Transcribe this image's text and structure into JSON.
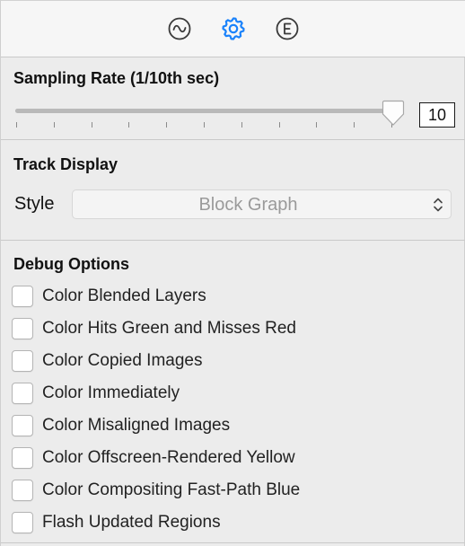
{
  "toolbar": {
    "icons": [
      {
        "name": "waveform-icon",
        "selected": false
      },
      {
        "name": "gear-icon",
        "selected": true
      },
      {
        "name": "e-circle-icon",
        "selected": false
      }
    ],
    "accent_color": "#1a82fb"
  },
  "sampling": {
    "title": "Sampling Rate (1/10th sec)",
    "value": "10",
    "slider_fraction": 1.0,
    "tick_count": 11
  },
  "track_display": {
    "title": "Track Display",
    "style_label": "Style",
    "style_value": "Block Graph"
  },
  "debug": {
    "title": "Debug Options",
    "options": [
      {
        "label": "Color Blended Layers",
        "checked": false
      },
      {
        "label": "Color Hits Green and Misses Red",
        "checked": false
      },
      {
        "label": "Color Copied Images",
        "checked": false
      },
      {
        "label": "Color Immediately",
        "checked": false
      },
      {
        "label": "Color Misaligned Images",
        "checked": false
      },
      {
        "label": "Color Offscreen-Rendered Yellow",
        "checked": false
      },
      {
        "label": "Color Compositing Fast-Path Blue",
        "checked": false
      },
      {
        "label": "Flash Updated Regions",
        "checked": false
      }
    ]
  }
}
